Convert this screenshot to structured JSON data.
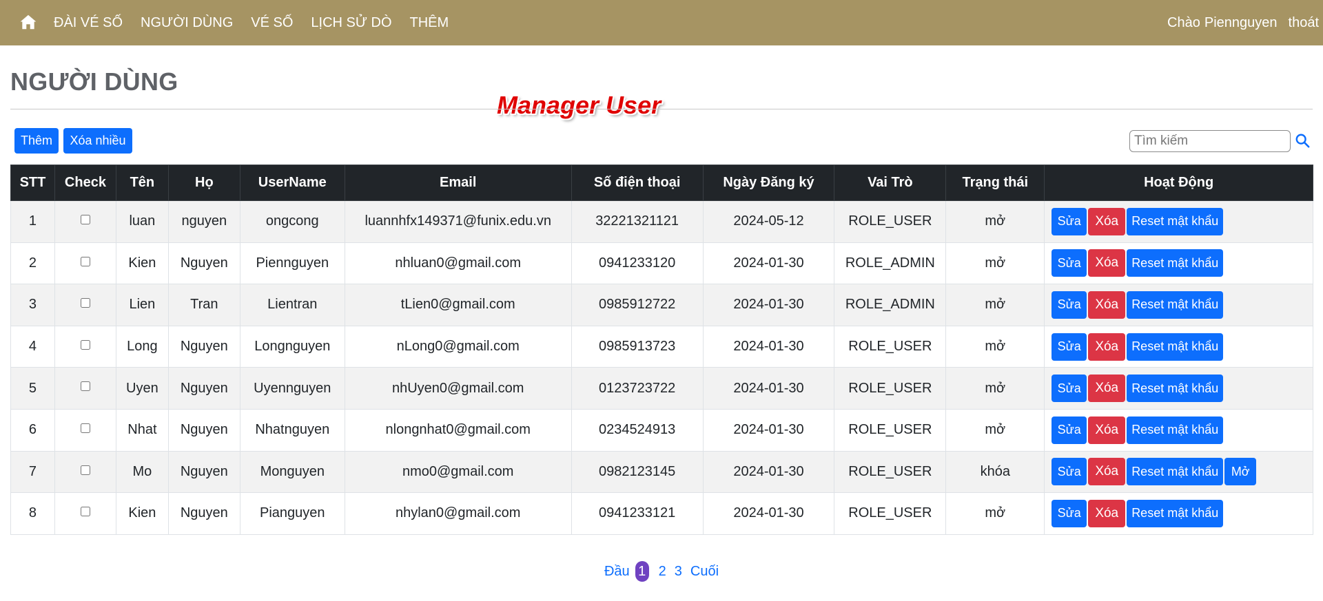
{
  "nav": {
    "home_icon": "home-icon",
    "links": [
      "ĐÀI VÉ SỐ",
      "NGƯỜI DÙNG",
      "VÉ SỐ",
      "LỊCH SỬ DÒ",
      "THÊM"
    ],
    "greeting": "Chào",
    "username": "Piennguyen",
    "logout": "thoát",
    "bg_color": "#a69463"
  },
  "page": {
    "title": "NGƯỜI DÙNG",
    "overlay_title": "Manager User"
  },
  "toolbar": {
    "add_label": "Thêm",
    "delete_many_label": "Xóa nhiều",
    "search_placeholder": "Tìm kiếm",
    "search_icon": "search-icon"
  },
  "table": {
    "headers": [
      "STT",
      "Check",
      "Tên",
      "Họ",
      "UserName",
      "Email",
      "Số điện thoại",
      "Ngày Đăng ký",
      "Vai Trò",
      "Trạng thái",
      "Hoạt Động"
    ],
    "rows": [
      {
        "stt": "1",
        "ten": "luan",
        "ho": "nguyen",
        "username": "ongcong",
        "email": "luannhfx149371@funix.edu.vn",
        "phone": "32221321121",
        "date": "2024-05-12",
        "role": "ROLE_USER",
        "status": "mở",
        "actions": [
          "Sửa",
          "Xóa",
          "Reset mật khẩu"
        ]
      },
      {
        "stt": "2",
        "ten": "Kien",
        "ho": "Nguyen",
        "username": "Piennguyen",
        "email": "nhluan0@gmail.com",
        "phone": "0941233120",
        "date": "2024-01-30",
        "role": "ROLE_ADMIN",
        "status": "mở",
        "actions": [
          "Sửa",
          "Xóa",
          "Reset mật khẩu"
        ]
      },
      {
        "stt": "3",
        "ten": "Lien",
        "ho": "Tran",
        "username": "Lientran",
        "email": "tLien0@gmail.com",
        "phone": "0985912722",
        "date": "2024-01-30",
        "role": "ROLE_ADMIN",
        "status": "mở",
        "actions": [
          "Sửa",
          "Xóa",
          "Reset mật khẩu"
        ]
      },
      {
        "stt": "4",
        "ten": "Long",
        "ho": "Nguyen",
        "username": "Longnguyen",
        "email": "nLong0@gmail.com",
        "phone": "0985913723",
        "date": "2024-01-30",
        "role": "ROLE_USER",
        "status": "mở",
        "actions": [
          "Sửa",
          "Xóa",
          "Reset mật khẩu"
        ]
      },
      {
        "stt": "5",
        "ten": "Uyen",
        "ho": "Nguyen",
        "username": "Uyennguyen",
        "email": "nhUyen0@gmail.com",
        "phone": "0123723722",
        "date": "2024-01-30",
        "role": "ROLE_USER",
        "status": "mở",
        "actions": [
          "Sửa",
          "Xóa",
          "Reset mật khẩu"
        ]
      },
      {
        "stt": "6",
        "ten": "Nhat",
        "ho": "Nguyen",
        "username": "Nhatnguyen",
        "email": "nlongnhat0@gmail.com",
        "phone": "0234524913",
        "date": "2024-01-30",
        "role": "ROLE_USER",
        "status": "mở",
        "actions": [
          "Sửa",
          "Xóa",
          "Reset mật khẩu"
        ]
      },
      {
        "stt": "7",
        "ten": "Mo",
        "ho": "Nguyen",
        "username": "Monguyen",
        "email": "nmo0@gmail.com",
        "phone": "0982123145",
        "date": "2024-01-30",
        "role": "ROLE_USER",
        "status": "khóa",
        "actions": [
          "Sửa",
          "Xóa",
          "Reset mật khẩu",
          "Mở"
        ]
      },
      {
        "stt": "8",
        "ten": "Kien",
        "ho": "Nguyen",
        "username": "Pianguyen",
        "email": "nhylan0@gmail.com",
        "phone": "0941233121",
        "date": "2024-01-30",
        "role": "ROLE_USER",
        "status": "mở",
        "actions": [
          "Sửa",
          "Xóa",
          "Reset mật khẩu"
        ]
      }
    ]
  },
  "pagination": {
    "first": "Đầu",
    "pages": [
      "1",
      "2",
      "3"
    ],
    "current": "1",
    "last": "Cuối"
  },
  "colors": {
    "primary": "#0d6efd",
    "danger": "#dc3545",
    "header_dark": "#212529",
    "active_page": "#6f42c1"
  }
}
